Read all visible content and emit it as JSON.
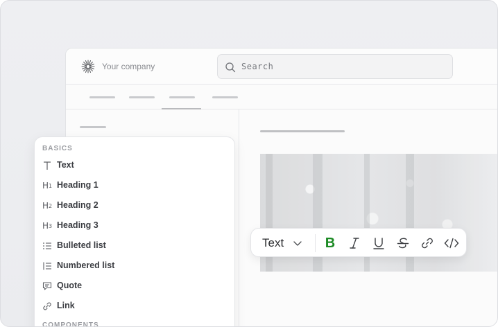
{
  "header": {
    "company": "Your company",
    "search_placeholder": "Search"
  },
  "toolbar": {
    "block_type": "Text",
    "bold_label": "B",
    "bold_color": "#1b8a23"
  },
  "menu": {
    "basics_title": "BASICS",
    "components_title": "COMPONENTS",
    "items": [
      {
        "label": "Text",
        "icon": "text-icon"
      },
      {
        "label": "Heading 1",
        "icon": "heading-1-icon"
      },
      {
        "label": "Heading 2",
        "icon": "heading-2-icon"
      },
      {
        "label": "Heading 3",
        "icon": "heading-3-icon"
      },
      {
        "label": "Bulleted list",
        "icon": "bulleted-list-icon"
      },
      {
        "label": "Numbered list",
        "icon": "numbered-list-icon"
      },
      {
        "label": "Quote",
        "icon": "quote-icon"
      },
      {
        "label": "Link",
        "icon": "link-icon"
      }
    ]
  }
}
